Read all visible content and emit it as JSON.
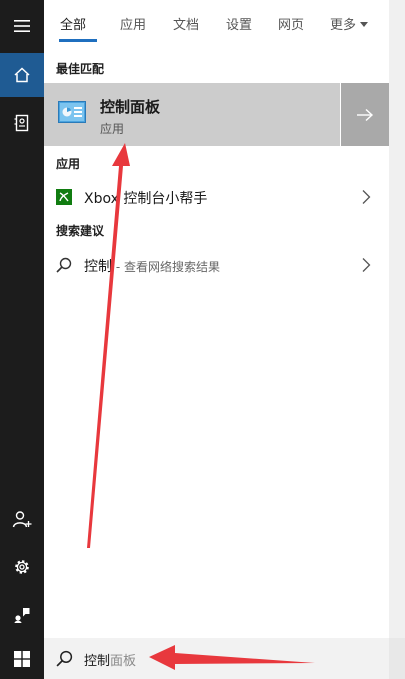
{
  "tabs": [
    {
      "label": "全部",
      "active": true
    },
    {
      "label": "应用",
      "active": false
    },
    {
      "label": "文档",
      "active": false
    },
    {
      "label": "设置",
      "active": false
    },
    {
      "label": "网页",
      "active": false
    },
    {
      "label": "更多",
      "active": false
    }
  ],
  "best_match": {
    "heading": "最佳匹配",
    "title": "控制面板",
    "subtitle": "应用"
  },
  "apps": {
    "heading": "应用",
    "items": [
      {
        "label": "Xbox 控制台小帮手"
      }
    ]
  },
  "suggestions": {
    "heading": "搜索建议",
    "items": [
      {
        "query": "控制",
        "detail": " - 查看网络搜索结果"
      }
    ]
  },
  "search": {
    "typed": "控制",
    "autocomplete": "面板"
  },
  "colors": {
    "accent": "#1f5b93",
    "annotation_arrow": "#e8383d"
  },
  "icons": {
    "rail": [
      "hamburger-menu-icon",
      "home-icon",
      "notebook-icon",
      "add-user-icon",
      "gear-icon",
      "feedback-icon"
    ],
    "start": "windows-logo-icon",
    "search": "search-icon"
  }
}
